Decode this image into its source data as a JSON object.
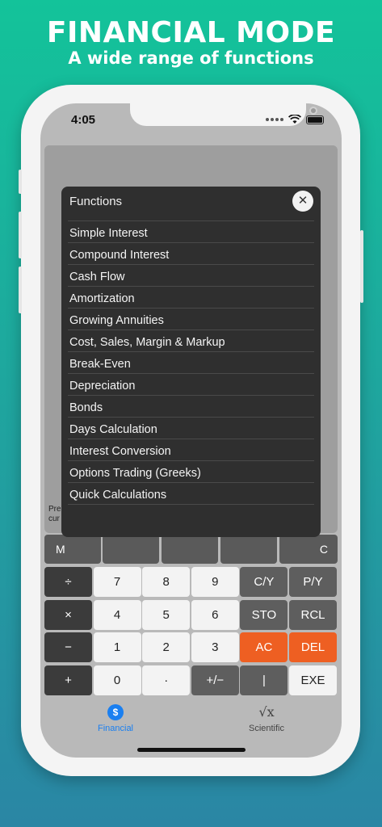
{
  "banner": {
    "title": "FINANCIAL MODE",
    "subtitle": "A wide range of functions"
  },
  "status_bar": {
    "time": "4:05",
    "icons": [
      "signal-dots-icon",
      "wifi-icon",
      "battery-icon"
    ]
  },
  "display": {
    "previous_text_line1": "Pre",
    "previous_text_line2": "cur"
  },
  "partial_row": {
    "left_label": "M",
    "right_label": "C"
  },
  "functions_modal": {
    "title": "Functions",
    "close_icon": "close-icon",
    "items": [
      "Simple Interest",
      "Compound Interest",
      "Cash Flow",
      "Amortization",
      "Growing Annuities",
      "Cost, Sales, Margin & Markup",
      "Break-Even",
      "Depreciation",
      "Bonds",
      "Days Calculation",
      "Interest Conversion",
      "Options Trading (Greeks)",
      "Quick Calculations"
    ]
  },
  "keypad": {
    "rows": [
      [
        "÷",
        "7",
        "8",
        "9",
        "C/Y",
        "P/Y"
      ],
      [
        "×",
        "4",
        "5",
        "6",
        "STO",
        "RCL"
      ],
      [
        "−",
        "1",
        "2",
        "3",
        "AC",
        "DEL"
      ],
      [
        "+",
        "0",
        "·",
        "+/−",
        "|",
        "EXE"
      ]
    ],
    "colors": {
      "operator": "#3b3b3b",
      "digit": "#f3f3f3",
      "function": "#5e5e5e",
      "accent": "#ee5f22"
    }
  },
  "tab_bar": {
    "tabs": [
      {
        "label": "Financial",
        "icon": "dollar-icon",
        "active": true,
        "color": "#1a7ff0"
      },
      {
        "label": "Scientific",
        "icon": "sqrt-x-icon",
        "active": false,
        "color": "#444444"
      }
    ]
  }
}
